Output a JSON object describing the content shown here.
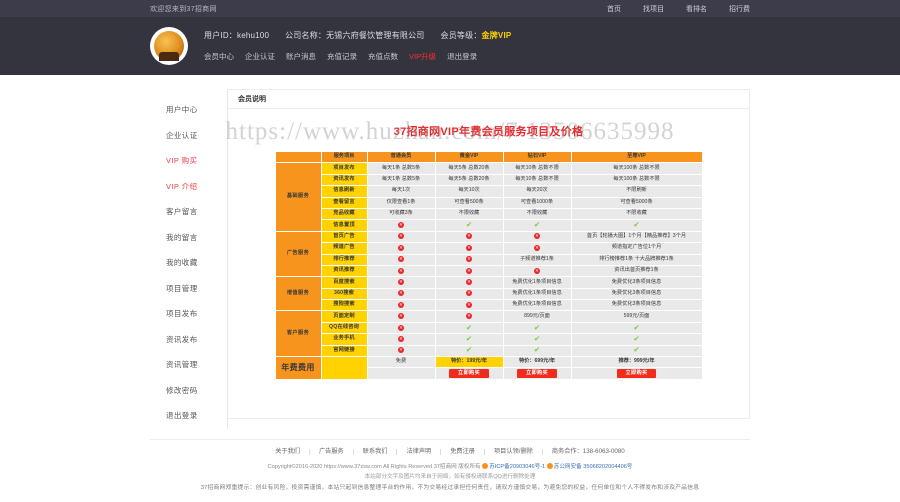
{
  "topbar": {
    "slogan": "欢迎您来到37招商网",
    "nav": [
      "首页",
      "找项目",
      "看排名",
      "招行费"
    ]
  },
  "userbar": {
    "avatar_icon": "user-avatar-icon",
    "id_label": "用户ID：kehu100",
    "company_label": "公司名称：无锡六府餐饮管理有限公司",
    "level_label": "会员等级：",
    "level_value": "金牌VIP",
    "links": [
      "会员中心",
      "企业认证",
      "账户消息",
      "充值记录",
      "充值点数"
    ],
    "hot_link": "VIP升级",
    "logout": "退出登录"
  },
  "sidebar": {
    "items": [
      {
        "label": "用户中心",
        "active": false
      },
      {
        "label": "企业认证",
        "active": false
      },
      {
        "label": "VIP 购买",
        "active": true
      },
      {
        "label": "VIP 介绍",
        "active": true
      },
      {
        "label": "客户留言",
        "active": false
      },
      {
        "label": "我的留言",
        "active": false
      },
      {
        "label": "我的收藏",
        "active": false
      },
      {
        "label": "项目管理",
        "active": false
      },
      {
        "label": "项目发布",
        "active": false
      },
      {
        "label": "资讯发布",
        "active": false
      },
      {
        "label": "资讯管理",
        "active": false
      },
      {
        "label": "修改密码",
        "active": false
      },
      {
        "label": "退出登录",
        "active": false
      }
    ]
  },
  "card": {
    "tab_label": "会员说明",
    "title": "37招商网VIP年费会员服务项目及价格"
  },
  "watermark": "https://www.huzhan.com/7 13506635998",
  "table": {
    "headers": [
      "服务项目",
      "普通会员",
      "黄金VIP",
      "钻石VIP",
      "至尊VIP"
    ],
    "groups": [
      {
        "name": "基础服务",
        "rows": [
          {
            "item": "项目发布",
            "cells": [
              "每天1条 总数5条",
              "每天5条 总数20条",
              "每天10条 总数不限",
              "每天100条 总数不限"
            ]
          },
          {
            "item": "资讯发布",
            "cells": [
              "每天1条 总数5条",
              "每天5条 总数20条",
              "每天10条 总数不限",
              "每天100条 总数不限"
            ]
          },
          {
            "item": "信息刷新",
            "cells": [
              "每天1次",
              "每天10次",
              "每天20次",
              "不限刷新"
            ]
          },
          {
            "item": "查看留言",
            "cells": [
              "仅限查看1条",
              "可查看500条",
              "可查看1000条",
              "可查看5000条"
            ]
          },
          {
            "item": "竞品收藏",
            "cells": [
              "可收藏3条",
              "不限收藏",
              "不限收藏",
              "不限收藏"
            ]
          },
          {
            "item": "信息置顶",
            "cells": [
              "no",
              "yes",
              "yes",
              "yes"
            ]
          }
        ]
      },
      {
        "name": "广告服务",
        "rows": [
          {
            "item": "首页广告",
            "cells": [
              "no",
              "no",
              "no",
              "首页【轮播大图】1个月【精品推荐】3个月"
            ]
          },
          {
            "item": "频道广告",
            "cells": [
              "no",
              "no",
              "no",
              "频道指定广告位1个月"
            ]
          },
          {
            "item": "排行推荐",
            "cells": [
              "no",
              "no",
              "子频道推荐1条",
              "排行榜推荐1条 十大品牌推荐1条"
            ]
          },
          {
            "item": "资讯推荐",
            "cells": [
              "no",
              "no",
              "no",
              "资讯出首页推荐1条"
            ]
          }
        ]
      },
      {
        "name": "增值服务",
        "rows": [
          {
            "item": "百度搜索",
            "cells": [
              "no",
              "no",
              "免费优化1条项目信息",
              "免费优化3条项目信息"
            ]
          },
          {
            "item": "360搜索",
            "cells": [
              "no",
              "no",
              "免费优化1条项目信息",
              "免费优化3条项目信息"
            ]
          },
          {
            "item": "搜狗搜索",
            "cells": [
              "no",
              "no",
              "免费优化1条项目信息",
              "免费优化3条项目信息"
            ]
          }
        ]
      },
      {
        "name": "客户服务",
        "rows": [
          {
            "item": "页面定制",
            "cells": [
              "no",
              "no",
              "899元/页面",
              "599元/页面"
            ]
          },
          {
            "item": "QQ在线咨询",
            "cells": [
              "no",
              "yes",
              "yes",
              "yes"
            ]
          },
          {
            "item": "业务手机",
            "cells": [
              "no",
              "yes",
              "yes",
              "yes"
            ]
          },
          {
            "item": "官网链接",
            "cells": [
              "no",
              "yes",
              "yes",
              "yes"
            ]
          }
        ]
      }
    ],
    "fee": {
      "group": "年费费用",
      "free": "免费",
      "prices": [
        "特价：199元/年",
        "特价：699元/年",
        "推荐：999元/年"
      ],
      "buy_label": "立即购买"
    }
  },
  "footer": {
    "nav": [
      "关于我们",
      "广告服务",
      "联系我们",
      "法律声明",
      "免费注册",
      "项目认领/删除",
      "商务合作：138-6063-0080"
    ],
    "copyright": "Copyright©2016-2020 https://www.37zsw.com All Rights Reserved  37招商网 版权所有",
    "icp": "苏ICP备20903046号-1",
    "police": "苏公网安备 35068202004406号",
    "notice": "本站部分文字及图片均来自于网络，如有侵权请联系QQ进行删除处理",
    "tip": "37招商网郑重提示：创业有风险，投资需谨慎，本站只起到信息整理平台的作用，不为交易经过承担任何责任，请双方谨慎交易，为避免您的权益，任何单位和个人不得发布和涉及产品信息"
  }
}
